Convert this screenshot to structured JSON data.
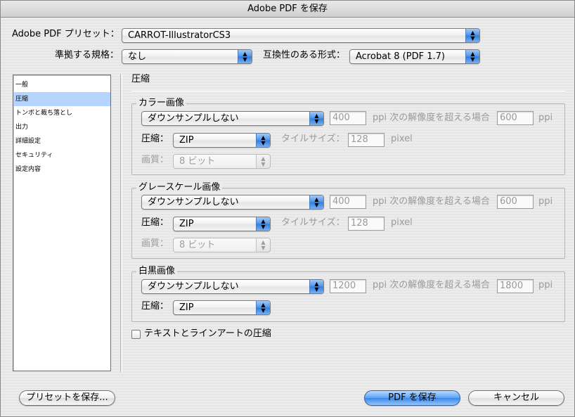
{
  "window": {
    "title": "Adobe PDF を保存"
  },
  "header": {
    "preset_label": "Adobe PDF プリセット：",
    "preset_value": "CARROT-IllustratorCS3",
    "standard_label": "準拠する規格：",
    "standard_value": "なし",
    "compat_label": "互換性のある形式：",
    "compat_value": "Acrobat 8 (PDF 1.7)"
  },
  "sidebar": {
    "items": [
      {
        "label": "一般"
      },
      {
        "label": "圧縮"
      },
      {
        "label": "トンボと裁ち落とし"
      },
      {
        "label": "出力"
      },
      {
        "label": "詳細設定"
      },
      {
        "label": "セキュリティ"
      },
      {
        "label": "設定内容"
      }
    ]
  },
  "panel": {
    "title": "圧縮"
  },
  "color": {
    "title": "カラー画像",
    "sampling": "ダウンサンプルしない",
    "ppi": "400",
    "ppi_unit_text": "ppi 次の解像度を超える場合",
    "above_ppi": "600",
    "ppi_unit": "ppi",
    "compression_label": "圧縮：",
    "compression": "ZIP",
    "tile_label": "タイルサイズ：",
    "tile": "128",
    "tile_unit": "pixel",
    "quality_label": "画質：",
    "quality": "8 ビット"
  },
  "gray": {
    "title": "グレースケール画像",
    "sampling": "ダウンサンプルしない",
    "ppi": "400",
    "ppi_unit_text": "ppi 次の解像度を超える場合",
    "above_ppi": "600",
    "ppi_unit": "ppi",
    "compression_label": "圧縮：",
    "compression": "ZIP",
    "tile_label": "タイルサイズ：",
    "tile": "128",
    "tile_unit": "pixel",
    "quality_label": "画質：",
    "quality": "8 ビット"
  },
  "mono": {
    "title": "白黒画像",
    "sampling": "ダウンサンプルしない",
    "ppi": "1200",
    "ppi_unit_text": "ppi 次の解像度を超える場合",
    "above_ppi": "1800",
    "ppi_unit": "ppi",
    "compression_label": "圧縮：",
    "compression": "ZIP"
  },
  "compress_text": {
    "label": "テキストとラインアートの圧縮",
    "checked": false
  },
  "buttons": {
    "save_preset": "プリセットを保存...",
    "save_pdf": "PDF を保存",
    "cancel": "キャンセル"
  },
  "icons": {
    "popup_arrows": "▲▼",
    "accent": "#3a87ea"
  }
}
